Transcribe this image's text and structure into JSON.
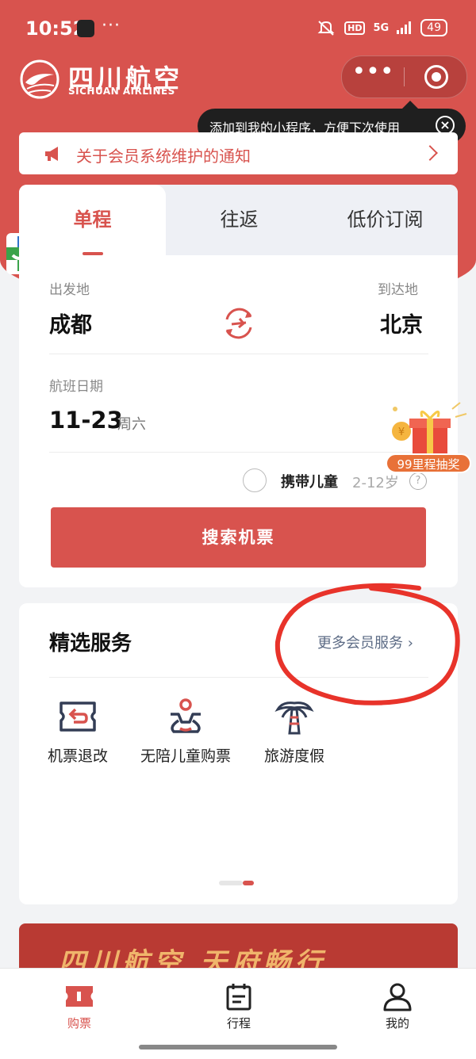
{
  "status_bar": {
    "time": "10:52",
    "dots": "···",
    "hd": "HD",
    "network": "5G",
    "battery": "49"
  },
  "header": {
    "brand_cn": "四川航空",
    "brand_en": "SICHUAN AIRLINES",
    "capsule_more": "•••"
  },
  "tooltip": {
    "text": "添加到我的小程序，方便下次使用",
    "close": "×"
  },
  "notice": {
    "text": "关于会员系统维护的通知"
  },
  "booking": {
    "tabs": [
      {
        "label": "单程",
        "active": true
      },
      {
        "label": "往返",
        "active": false
      },
      {
        "label": "低价订阅",
        "active": false
      }
    ],
    "origin_label": "出发地",
    "origin_city": "成都",
    "destination_label": "到达地",
    "destination_city": "北京",
    "date_label": "航班日期",
    "date": "11-23",
    "weekday": "周六",
    "child_label": "携带儿童",
    "child_age": "2-12岁",
    "help": "?",
    "search_button": "搜索机票"
  },
  "lottery": {
    "tag": "99里程抽奖"
  },
  "services": {
    "title": "精选服务",
    "more": "更多会员服务 ›",
    "items": [
      {
        "label": "机票退改",
        "icon": "ticket-refund-icon"
      },
      {
        "label": "无陪儿童购票",
        "icon": "unaccompanied-child-icon"
      },
      {
        "label": "旅游度假",
        "icon": "palm-tree-icon"
      }
    ]
  },
  "banner": {
    "text": "四川航空 天府畅行"
  },
  "bottom_nav": [
    {
      "label": "购票",
      "icon": "ticket-icon",
      "active": true
    },
    {
      "label": "行程",
      "icon": "itinerary-icon",
      "active": false
    },
    {
      "label": "我的",
      "icon": "user-icon",
      "active": false
    }
  ],
  "colors": {
    "brand_red": "#d8534e",
    "link_gray_blue": "#5c6b85",
    "annotation_red": "#e8332a"
  }
}
